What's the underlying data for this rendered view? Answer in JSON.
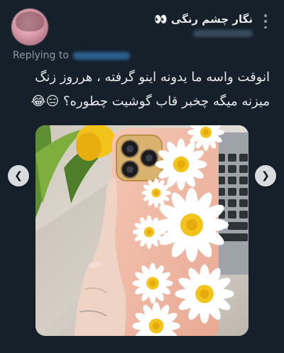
{
  "tweet": {
    "author_name": "نگار چشم رنگی 👀",
    "replying_label": "Replying to",
    "text_lines": [
      "انوقت واسه ما یدونه اینو گرفته ، هرروز زنگ",
      "میزنه میگه چخبر قاب گوشیت چطوره؟ 😑😂"
    ]
  },
  "icons": {
    "more": "more-vertical-icon",
    "prev": "chevron-left-icon",
    "next": "chevron-right-icon"
  },
  "carousel": {
    "prev_glyph": "❮",
    "next_glyph": "❯"
  },
  "colors": {
    "background": "#15202b",
    "text": "#e7e9ea",
    "muted": "#8b98a5",
    "phone_case": "#f0b9a3"
  }
}
